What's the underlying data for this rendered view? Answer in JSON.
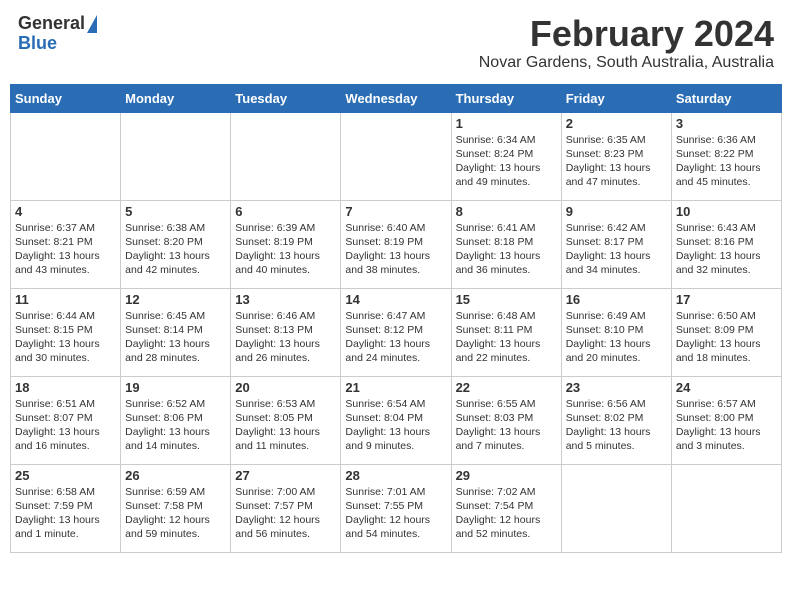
{
  "header": {
    "logo_general": "General",
    "logo_blue": "Blue",
    "title": "February 2024",
    "subtitle": "Novar Gardens, South Australia, Australia"
  },
  "weekdays": [
    "Sunday",
    "Monday",
    "Tuesday",
    "Wednesday",
    "Thursday",
    "Friday",
    "Saturday"
  ],
  "weeks": [
    [
      {
        "day": "",
        "info": ""
      },
      {
        "day": "",
        "info": ""
      },
      {
        "day": "",
        "info": ""
      },
      {
        "day": "",
        "info": ""
      },
      {
        "day": "1",
        "info": "Sunrise: 6:34 AM\nSunset: 8:24 PM\nDaylight: 13 hours and 49 minutes."
      },
      {
        "day": "2",
        "info": "Sunrise: 6:35 AM\nSunset: 8:23 PM\nDaylight: 13 hours and 47 minutes."
      },
      {
        "day": "3",
        "info": "Sunrise: 6:36 AM\nSunset: 8:22 PM\nDaylight: 13 hours and 45 minutes."
      }
    ],
    [
      {
        "day": "4",
        "info": "Sunrise: 6:37 AM\nSunset: 8:21 PM\nDaylight: 13 hours and 43 minutes."
      },
      {
        "day": "5",
        "info": "Sunrise: 6:38 AM\nSunset: 8:20 PM\nDaylight: 13 hours and 42 minutes."
      },
      {
        "day": "6",
        "info": "Sunrise: 6:39 AM\nSunset: 8:19 PM\nDaylight: 13 hours and 40 minutes."
      },
      {
        "day": "7",
        "info": "Sunrise: 6:40 AM\nSunset: 8:19 PM\nDaylight: 13 hours and 38 minutes."
      },
      {
        "day": "8",
        "info": "Sunrise: 6:41 AM\nSunset: 8:18 PM\nDaylight: 13 hours and 36 minutes."
      },
      {
        "day": "9",
        "info": "Sunrise: 6:42 AM\nSunset: 8:17 PM\nDaylight: 13 hours and 34 minutes."
      },
      {
        "day": "10",
        "info": "Sunrise: 6:43 AM\nSunset: 8:16 PM\nDaylight: 13 hours and 32 minutes."
      }
    ],
    [
      {
        "day": "11",
        "info": "Sunrise: 6:44 AM\nSunset: 8:15 PM\nDaylight: 13 hours and 30 minutes."
      },
      {
        "day": "12",
        "info": "Sunrise: 6:45 AM\nSunset: 8:14 PM\nDaylight: 13 hours and 28 minutes."
      },
      {
        "day": "13",
        "info": "Sunrise: 6:46 AM\nSunset: 8:13 PM\nDaylight: 13 hours and 26 minutes."
      },
      {
        "day": "14",
        "info": "Sunrise: 6:47 AM\nSunset: 8:12 PM\nDaylight: 13 hours and 24 minutes."
      },
      {
        "day": "15",
        "info": "Sunrise: 6:48 AM\nSunset: 8:11 PM\nDaylight: 13 hours and 22 minutes."
      },
      {
        "day": "16",
        "info": "Sunrise: 6:49 AM\nSunset: 8:10 PM\nDaylight: 13 hours and 20 minutes."
      },
      {
        "day": "17",
        "info": "Sunrise: 6:50 AM\nSunset: 8:09 PM\nDaylight: 13 hours and 18 minutes."
      }
    ],
    [
      {
        "day": "18",
        "info": "Sunrise: 6:51 AM\nSunset: 8:07 PM\nDaylight: 13 hours and 16 minutes."
      },
      {
        "day": "19",
        "info": "Sunrise: 6:52 AM\nSunset: 8:06 PM\nDaylight: 13 hours and 14 minutes."
      },
      {
        "day": "20",
        "info": "Sunrise: 6:53 AM\nSunset: 8:05 PM\nDaylight: 13 hours and 11 minutes."
      },
      {
        "day": "21",
        "info": "Sunrise: 6:54 AM\nSunset: 8:04 PM\nDaylight: 13 hours and 9 minutes."
      },
      {
        "day": "22",
        "info": "Sunrise: 6:55 AM\nSunset: 8:03 PM\nDaylight: 13 hours and 7 minutes."
      },
      {
        "day": "23",
        "info": "Sunrise: 6:56 AM\nSunset: 8:02 PM\nDaylight: 13 hours and 5 minutes."
      },
      {
        "day": "24",
        "info": "Sunrise: 6:57 AM\nSunset: 8:00 PM\nDaylight: 13 hours and 3 minutes."
      }
    ],
    [
      {
        "day": "25",
        "info": "Sunrise: 6:58 AM\nSunset: 7:59 PM\nDaylight: 13 hours and 1 minute."
      },
      {
        "day": "26",
        "info": "Sunrise: 6:59 AM\nSunset: 7:58 PM\nDaylight: 12 hours and 59 minutes."
      },
      {
        "day": "27",
        "info": "Sunrise: 7:00 AM\nSunset: 7:57 PM\nDaylight: 12 hours and 56 minutes."
      },
      {
        "day": "28",
        "info": "Sunrise: 7:01 AM\nSunset: 7:55 PM\nDaylight: 12 hours and 54 minutes."
      },
      {
        "day": "29",
        "info": "Sunrise: 7:02 AM\nSunset: 7:54 PM\nDaylight: 12 hours and 52 minutes."
      },
      {
        "day": "",
        "info": ""
      },
      {
        "day": "",
        "info": ""
      }
    ]
  ]
}
